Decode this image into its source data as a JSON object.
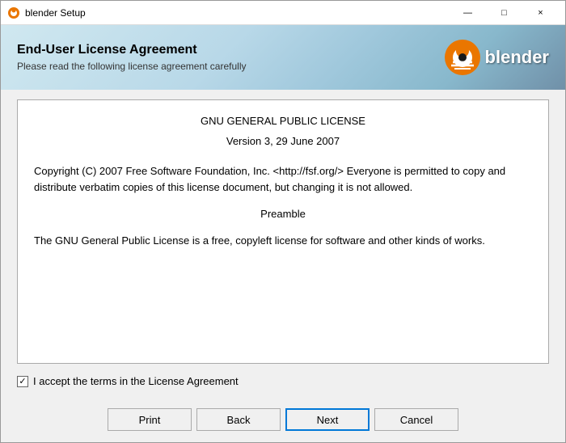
{
  "window": {
    "title": "blender Setup",
    "minimize_label": "—",
    "maximize_label": "□",
    "close_label": "×"
  },
  "header": {
    "title": "End-User License Agreement",
    "subtitle": "Please read the following license agreement carefully",
    "logo_text": "blender"
  },
  "license": {
    "title": "GNU GENERAL PUBLIC LICENSE",
    "version_line": "Version 3, 29 June 2007",
    "para1": "Copyright (C) 2007 Free Software Foundation, Inc. <http://fsf.org/> Everyone is permitted to copy and distribute verbatim copies of this license document, but changing it is not allowed.",
    "section_title": "Preamble",
    "para2": "The GNU General Public License is a free, copyleft license for software and other kinds of works."
  },
  "accept": {
    "label": "I accept the terms in the License Agreement",
    "checked": true
  },
  "buttons": {
    "print": "Print",
    "back": "Back",
    "next": "Next",
    "cancel": "Cancel"
  }
}
